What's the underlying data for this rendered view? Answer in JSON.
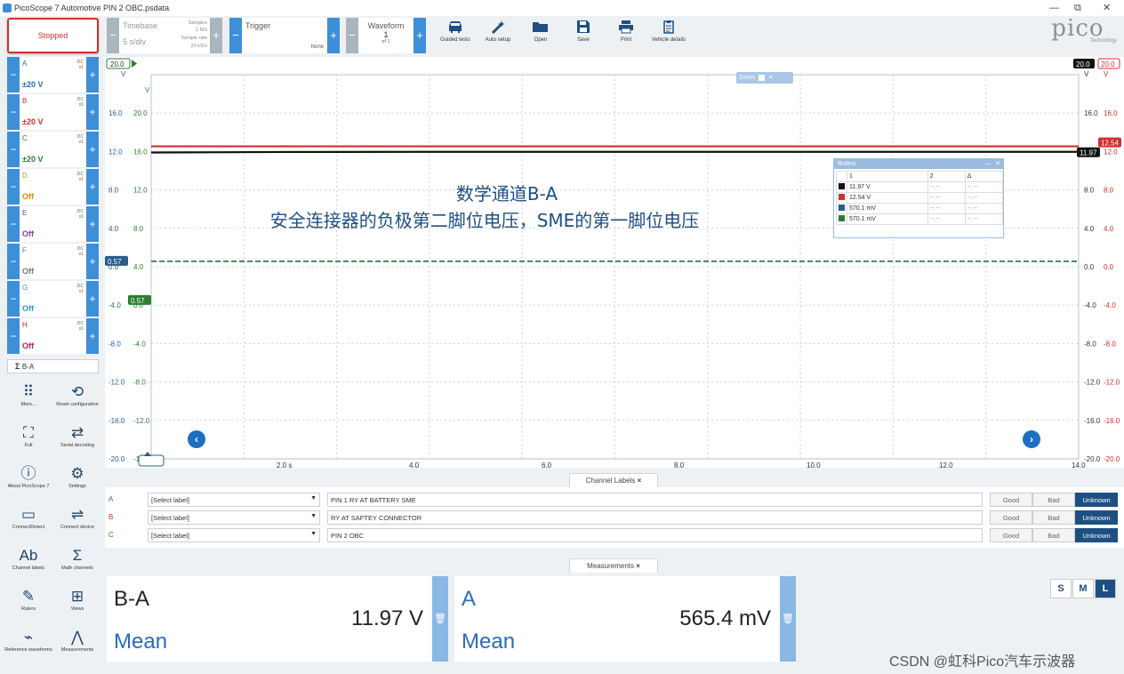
{
  "window": {
    "title": "PicoScope 7 Automotive PIN 2 OBC.psdata",
    "controls": [
      "—",
      "⧉",
      "✕"
    ]
  },
  "toolbar": {
    "run_state": "Stopped",
    "timebase": {
      "label": "Timebase",
      "value": "5 s/div",
      "samples_label": "Samples",
      "samples_value": "1 MS",
      "rate_label": "Sample rate",
      "rate_value": "20 kS/s"
    },
    "trigger": {
      "label": "Trigger",
      "mode": "None"
    },
    "waveform": {
      "label": "Waveform",
      "current": "1",
      "of": "of 1"
    },
    "buttons": [
      {
        "label": "Guided tests",
        "icon": "car-icon"
      },
      {
        "label": "Auto setup",
        "icon": "wand-icon"
      },
      {
        "label": "Open",
        "icon": "folder-icon"
      },
      {
        "label": "Save",
        "icon": "save-icon"
      },
      {
        "label": "Print",
        "icon": "print-icon"
      },
      {
        "label": "Vehicle details",
        "icon": "clipboard-icon"
      }
    ],
    "logo": "pico",
    "logo_sub": "Technology"
  },
  "channels": [
    {
      "id": "A",
      "coupling": "DC",
      "probe": "x1",
      "range": "±20 V",
      "color": "#2b6bb5"
    },
    {
      "id": "B",
      "coupling": "DC",
      "probe": "x1",
      "range": "±20 V",
      "color": "#d32f2f"
    },
    {
      "id": "C",
      "coupling": "DC",
      "probe": "x1",
      "range": "±20 V",
      "color": "#2e7d32"
    },
    {
      "id": "D",
      "coupling": "DC",
      "probe": "x1",
      "range": "Off",
      "color": "#e08a00"
    },
    {
      "id": "E",
      "coupling": "DC",
      "probe": "x1",
      "range": "Off",
      "color": "#7b3fa0"
    },
    {
      "id": "F",
      "coupling": "DC",
      "probe": "x1",
      "range": "Off",
      "color": "#777777"
    },
    {
      "id": "G",
      "coupling": "DC",
      "probe": "x1",
      "range": "Off",
      "color": "#2b9bd8"
    },
    {
      "id": "H",
      "coupling": "DC",
      "probe": "x1",
      "range": "Off",
      "color": "#c2185b"
    }
  ],
  "math_channel": {
    "symbol": "Σ",
    "label": "B-A"
  },
  "side_buttons": [
    {
      "label": "More...",
      "icon": "grid-icon"
    },
    {
      "label": "Reset configuration",
      "icon": "history-icon"
    },
    {
      "label": "Full",
      "icon": "fullscreen-icon"
    },
    {
      "label": "Serial decoding",
      "icon": "shuffle-icon"
    },
    {
      "label": "About PicoScope 7",
      "icon": "info-icon"
    },
    {
      "label": "Settings",
      "icon": "gear-icon"
    },
    {
      "label": "ConnectDetect",
      "icon": "ab-icon"
    },
    {
      "label": "Connect device",
      "icon": "usb-icon"
    },
    {
      "label": "Channel labels",
      "icon": "abcd-icon"
    },
    {
      "label": "Math channels",
      "icon": "sigma-icon"
    },
    {
      "label": "Rulers",
      "icon": "ruler-icon"
    },
    {
      "label": "Views",
      "icon": "views-icon"
    },
    {
      "label": "Reference waveforms",
      "icon": "waveform-icon"
    },
    {
      "label": "Measurements",
      "icon": "compass-icon"
    }
  ],
  "plot": {
    "x_ticks": [
      "2.0 s",
      "4.0",
      "6.0",
      "8.0",
      "10.0",
      "12.0",
      "14.0"
    ],
    "y_ticks_outer": [
      "16.0",
      "12.0",
      "8.0",
      "4.0",
      "0.0",
      "-4.0",
      "-8.0",
      "-12.0",
      "-16.0",
      "-20.0"
    ],
    "y_ticks_inner": [
      "20.0",
      "16.0",
      "12.0",
      "8.0",
      "4.0",
      "0.0",
      "-4.0",
      "-8.0",
      "-12.0",
      "-16.0"
    ],
    "unit": "V",
    "top_marker": "20.0",
    "left_markers": [
      "0.57",
      "0.57"
    ],
    "right_markers": [
      "20.0",
      "20.0"
    ],
    "trace_tags": [
      "11.97",
      "12.54"
    ],
    "zoom_label": "Zoom",
    "annotation_line1": "数学通道B-A",
    "annotation_line2": "安全连接器的负极第二脚位电压，SME的第一脚位电压",
    "colors": {
      "red": "#d32f2f",
      "black": "#111111",
      "blue": "#2b5c8a",
      "green": "#2e7d32",
      "grid": "#c9d4df"
    }
  },
  "chart_data": {
    "type": "line",
    "title": "",
    "xlabel": "",
    "ylabel": "V",
    "x": [
      0,
      2,
      4,
      6,
      8,
      10,
      12,
      14
    ],
    "xlim": [
      0,
      14
    ],
    "ylim": [
      -20,
      20
    ],
    "series": [
      {
        "name": "B",
        "values": [
          12.54,
          12.54,
          12.54,
          12.54,
          12.54,
          12.54,
          12.54,
          12.54
        ]
      },
      {
        "name": "B-A",
        "values": [
          11.9,
          11.95,
          11.97,
          11.97,
          11.97,
          11.97,
          11.97,
          11.97
        ]
      },
      {
        "name": "A",
        "values": [
          0.57,
          0.57,
          0.57,
          0.57,
          0.57,
          0.57,
          0.57,
          0.57
        ]
      },
      {
        "name": "C",
        "values": [
          0.57,
          0.57,
          0.57,
          0.57,
          0.57,
          0.57,
          0.57,
          0.57
        ]
      }
    ]
  },
  "rulers_panel": {
    "title": "Rulers",
    "headers": [
      "",
      "1",
      "2",
      "Δ"
    ],
    "rows": [
      {
        "color": "#111111",
        "v1": "11.97 V",
        "v2": "--.--",
        "d": "--.--"
      },
      {
        "color": "#d32f2f",
        "v1": "12.54 V",
        "v2": "--.--",
        "d": "--.--"
      },
      {
        "color": "#2b5c8a",
        "v1": "570.1 mV",
        "v2": "--.--",
        "d": "--.--"
      },
      {
        "color": "#2e7d32",
        "v1": "570.1 mV",
        "v2": "--.--",
        "d": "--.--"
      }
    ]
  },
  "channel_labels": {
    "tab": "Channel Labels",
    "rows": [
      {
        "ch": "A",
        "select": "[Select label]",
        "text": "PIN 1 RY AT BATTERY SME",
        "color": "#2b6bb5"
      },
      {
        "ch": "B",
        "select": "[Select label]",
        "text": "RY AT SAFTEY CONNECTOR",
        "color": "#d32f2f"
      },
      {
        "ch": "C",
        "select": "[Select label]",
        "text": "PIN 2 OBC",
        "color": "#2e7d32"
      }
    ],
    "buttons": [
      "Good",
      "Bad",
      "Unknown"
    ]
  },
  "measurements": {
    "tab": "Measurements",
    "cards": [
      {
        "channel": "B-A",
        "value": "11.97 V",
        "type": "Mean"
      },
      {
        "channel": "A",
        "value": "565.4 mV",
        "type": "Mean"
      }
    ],
    "size_buttons": [
      "S",
      "M",
      "L"
    ]
  },
  "watermark": "CSDN @虹科Pico汽车示波器"
}
